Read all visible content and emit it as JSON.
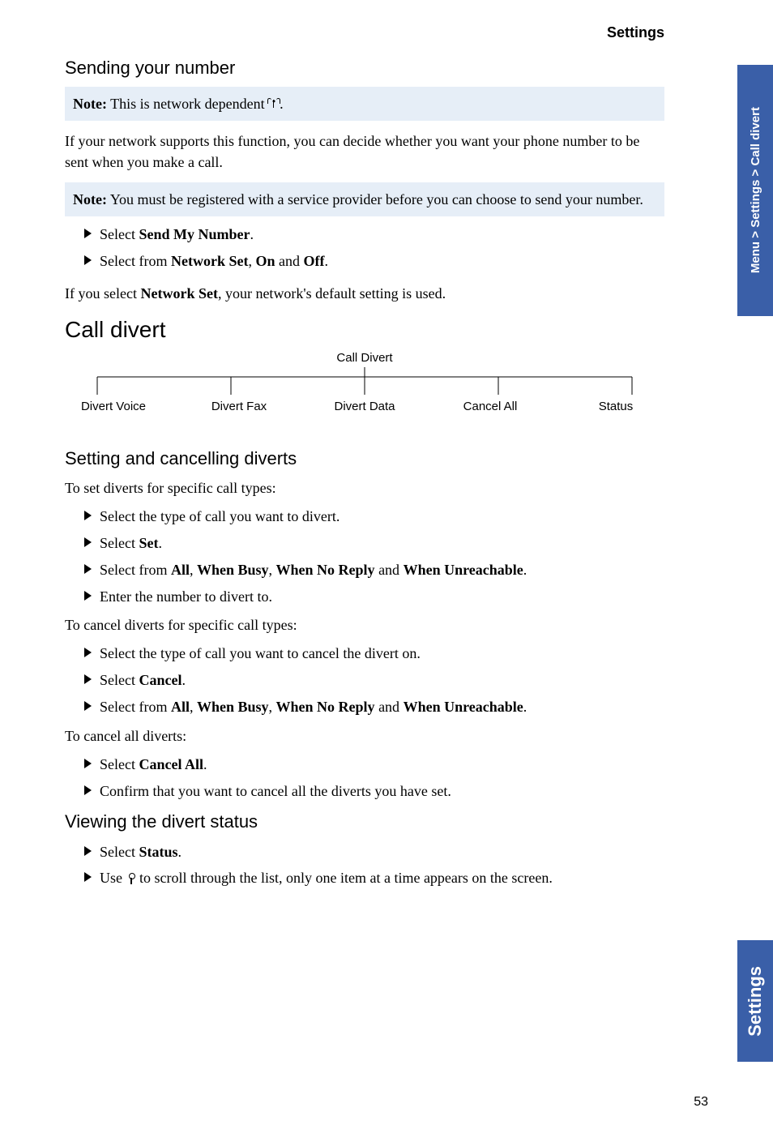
{
  "header": {
    "section": "Settings"
  },
  "sideTabs": {
    "breadcrumb": "Menu > Settings > Call divert",
    "chapter": "Settings"
  },
  "sending": {
    "heading": "Sending your number",
    "note1_label": "Note:",
    "note1_text": " This is network dependent ",
    "note1_after_icon": ".",
    "body": "If your network supports this function, you can decide whether you want your phone number to be sent when you make a call.",
    "note2_label": "Note:",
    "note2_text": " You must be registered with a service provider before you can choose to send your number.",
    "bullet1_pre": "Select ",
    "bullet1_b": "Send My Number",
    "bullet1_post": ".",
    "bullet2_pre": "Select from ",
    "bullet2_b1": "Network Set",
    "bullet2_mid1": ", ",
    "bullet2_b2": "On",
    "bullet2_mid2": " and ",
    "bullet2_b3": "Off",
    "bullet2_post": ".",
    "body2_pre": "If you select ",
    "body2_b": "Network Set",
    "body2_post": ", your network's default setting is used."
  },
  "callDivert": {
    "heading": "Call divert",
    "root": "Call Divert",
    "leaves": [
      "Divert Voice",
      "Divert Fax",
      "Divert Data",
      "Cancel All",
      "Status"
    ]
  },
  "setting": {
    "heading": "Setting and cancelling diverts",
    "intro1": "To set diverts for specific call types:",
    "b1": "Select the type of call you want to divert.",
    "b2_pre": "Select ",
    "b2_b": "Set",
    "b2_post": ".",
    "b3_pre": "Select from ",
    "b3_b1": "All",
    "b3_m1": ", ",
    "b3_b2": "When Busy",
    "b3_m2": ", ",
    "b3_b3": "When No Reply",
    "b3_m3": " and ",
    "b3_b4": "When Unreachable",
    "b3_post": ".",
    "b4": "Enter the number to divert to.",
    "intro2": "To cancel diverts for specific call types:",
    "c1": "Select the type of call you want to cancel the divert on.",
    "c2_pre": "Select ",
    "c2_b": "Cancel",
    "c2_post": ".",
    "c3_pre": "Select from ",
    "c3_b1": "All",
    "c3_m1": ", ",
    "c3_b2": "When Busy",
    "c3_m2": ", ",
    "c3_b3": "When No Reply",
    "c3_m3": " and ",
    "c3_b4": "When Unreachable",
    "c3_post": ".",
    "intro3": "To cancel all diverts:",
    "d1_pre": "Select ",
    "d1_b": "Cancel All",
    "d1_post": ".",
    "d2": "Confirm that you want to cancel all the diverts you have set."
  },
  "viewing": {
    "heading": "Viewing the divert status",
    "v1_pre": "Select ",
    "v1_b": "Status",
    "v1_post": ".",
    "v2_pre": "Use ",
    "v2_post": " to scroll through the list, only one item at a time appears on the screen."
  },
  "pageNumber": "53"
}
